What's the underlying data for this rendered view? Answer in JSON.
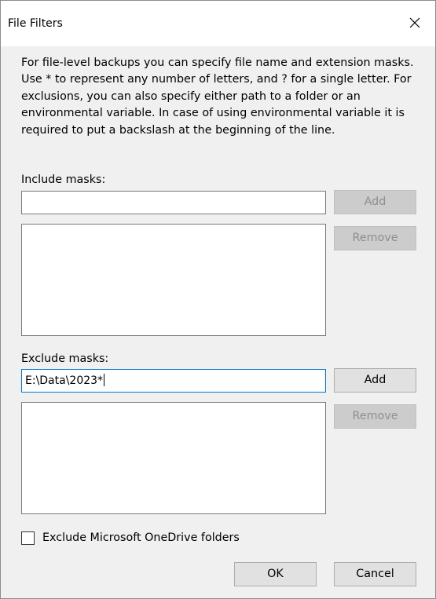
{
  "window": {
    "title": "File Filters",
    "close_icon": "close-icon"
  },
  "description": "For file-level backups you can specify file name and extension masks. Use * to represent any number of letters, and ? for a single letter. For exclusions, you can also specify either path to a folder or an environmental variable. In case of using environmental variable it is required to put a backslash at the beginning of the line.",
  "include": {
    "label": "Include masks:",
    "input_value": "",
    "items": [],
    "add_label": "Add",
    "remove_label": "Remove",
    "add_enabled": false,
    "remove_enabled": false
  },
  "exclude": {
    "label": "Exclude masks:",
    "input_value": "E:\\Data\\2023*",
    "items": [],
    "add_label": "Add",
    "remove_label": "Remove",
    "add_enabled": true,
    "remove_enabled": false
  },
  "onedrive": {
    "label": "Exclude Microsoft OneDrive folders",
    "checked": false
  },
  "footer": {
    "ok_label": "OK",
    "cancel_label": "Cancel"
  },
  "colors": {
    "dialog_bg": "#f0f0f0",
    "focus_border": "#0078d7",
    "button_bg": "#e1e1e1",
    "disabled_button_bg": "#cccccc",
    "disabled_text": "#8f8f8f"
  }
}
